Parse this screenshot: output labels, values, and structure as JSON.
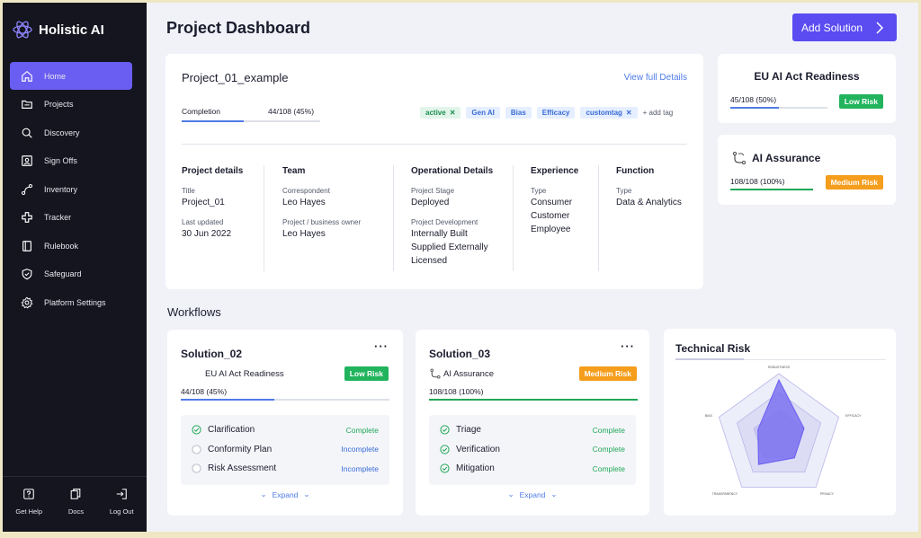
{
  "brand": {
    "name": "Holistic AI"
  },
  "nav": [
    {
      "label": "Home",
      "icon": "home-icon"
    },
    {
      "label": "Projects",
      "icon": "folder-icon"
    },
    {
      "label": "Discovery",
      "icon": "search-icon"
    },
    {
      "label": "Sign Offs",
      "icon": "user-card-icon"
    },
    {
      "label": "Inventory",
      "icon": "nodes-icon"
    },
    {
      "label": "Tracker",
      "icon": "puzzle-icon"
    },
    {
      "label": "Rulebook",
      "icon": "book-icon"
    },
    {
      "label": "Safeguard",
      "icon": "shield-icon"
    },
    {
      "label": "Platform Settings",
      "icon": "gear-icon"
    }
  ],
  "bottom": [
    {
      "label": "Get Help",
      "icon": "help-icon"
    },
    {
      "label": "Docs",
      "icon": "docs-icon"
    },
    {
      "label": "Log Out",
      "icon": "logout-icon"
    }
  ],
  "page": {
    "title": "Project Dashboard",
    "add_button": "Add Solution"
  },
  "project": {
    "name": "Project_01_example",
    "view_link": "View full Details",
    "completion_label": "Completion",
    "completion_value": "44/108 (45%)",
    "completion_fraction": 0.45,
    "tags": [
      "active",
      "Gen AI",
      "Bias",
      "Efficacy",
      "customtag"
    ],
    "add_tag": "+ add tag",
    "details": {
      "heading": "Project details",
      "title_label": "Title",
      "title_value": "Project_01",
      "updated_label": "Last updated",
      "updated_value": "30 Jun 2022"
    },
    "team": {
      "heading": "Team",
      "correspondent_label": "Correspondent",
      "correspondent_value": "Leo Hayes",
      "owner_label": "Project / business owner",
      "owner_value": "Leo Hayes"
    },
    "operational": {
      "heading": "Operational Details",
      "stage_label": "Project Stage",
      "stage_value": "Deployed",
      "dev_label": "Project Development",
      "dev_values": [
        "Internally Built",
        "Supplied Externally",
        "Licensed"
      ]
    },
    "experience": {
      "heading": "Experience",
      "type_label": "Type",
      "values": [
        "Consumer",
        "Customer",
        "Employee"
      ]
    },
    "function": {
      "heading": "Function",
      "type_label": "Type",
      "value": "Data & Analytics"
    }
  },
  "eu_card": {
    "title": "EU AI Act Readiness",
    "value": "45/108 (50%)",
    "fraction": 0.5,
    "badge": "Low Risk"
  },
  "assurance_card": {
    "title": "AI Assurance",
    "value": "108/108 (100%)",
    "fraction": 1.0,
    "badge": "Medium Risk"
  },
  "workflows": {
    "heading": "Workflows",
    "items": [
      {
        "name": "Solution_02",
        "type": "EU AI Act Readiness",
        "badge": "Low Risk",
        "value": "44/108 (45%)",
        "fraction": 0.45,
        "steps": [
          {
            "label": "Clarification",
            "status": "Complete"
          },
          {
            "label": "Conformity Plan",
            "status": "Incomplete"
          },
          {
            "label": "Risk Assessment",
            "status": "Incomplete"
          }
        ],
        "expand": "Expand"
      },
      {
        "name": "Solution_03",
        "type": "AI Assurance",
        "badge": "Medium Risk",
        "value": "108/108 (100%)",
        "fraction": 1.0,
        "steps": [
          {
            "label": "Triage",
            "status": "Complete"
          },
          {
            "label": "Verification",
            "status": "Complete"
          },
          {
            "label": "Mitigation",
            "status": "Complete"
          }
        ],
        "expand": "Expand"
      }
    ]
  },
  "technical_risk": {
    "title": "Technical Risk",
    "axes": [
      "ROBUSTNESS",
      "EFFICACY",
      "PRIVACY",
      "TRANSPARENCY",
      "BIAS"
    ],
    "values": [
      0.9,
      0.42,
      0.42,
      0.55,
      0.35
    ]
  },
  "colors": {
    "accent": "#5a4cf0",
    "sidebar": "#14151f",
    "green": "#21b45d",
    "orange": "#f59d1c",
    "blue_bar": "#4f7be8"
  }
}
